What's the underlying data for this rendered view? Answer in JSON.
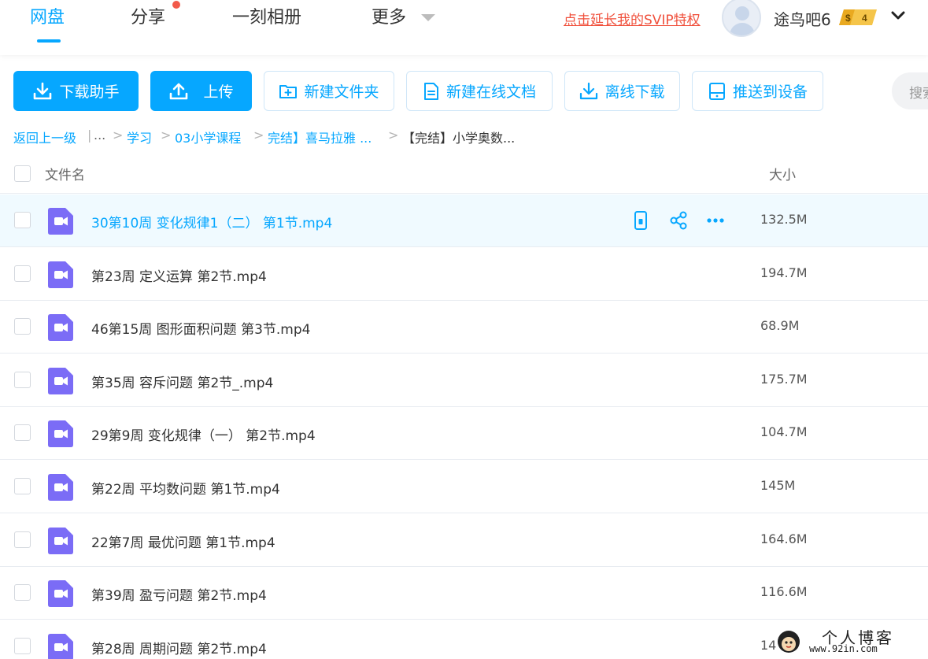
{
  "nav": {
    "tabs": [
      {
        "label": "网盘",
        "active": true
      },
      {
        "label": "分享",
        "has_dot": true
      },
      {
        "label": "一刻相册"
      },
      {
        "label": "更多"
      }
    ],
    "svip_link": "点击延长我的SVIP特权",
    "username": "途鸟吧6",
    "vip_level": "4",
    "vip_currency": "$"
  },
  "toolbar": {
    "download_helper": "下载助手",
    "upload": "上传",
    "new_folder": "新建文件夹",
    "new_online_doc": "新建在线文档",
    "offline_download": "离线下载",
    "push_to_device": "推送到设备",
    "search_placeholder": "搜索"
  },
  "breadcrumb": {
    "back": "返回上一级",
    "divider": "|",
    "ellipsis": "...",
    "items": [
      "学习",
      "03小学课程",
      "完结】喜马拉雅 ...",
      "【完结】小学奥数..."
    ]
  },
  "list": {
    "header_name": "文件名",
    "header_size": "大小",
    "files": [
      {
        "name": "30第10周 变化规律1（二） 第1节.mp4",
        "size": "132.5M",
        "hover": true
      },
      {
        "name": "第23周 定义运算 第2节.mp4",
        "size": "194.7M"
      },
      {
        "name": "46第15周 图形面积问题 第3节.mp4",
        "size": "68.9M"
      },
      {
        "name": "第35周 容斥问题 第2节_.mp4",
        "size": "175.7M"
      },
      {
        "name": "29第9周 变化规律（一） 第2节.mp4",
        "size": "104.7M"
      },
      {
        "name": "第22周 平均数问题 第1节.mp4",
        "size": "145M"
      },
      {
        "name": "22第7周 最优问题 第1节.mp4",
        "size": "164.6M"
      },
      {
        "name": "第39周 盈亏问题 第2节.mp4",
        "size": "116.6M"
      },
      {
        "name": "第28周 周期问题 第2节.mp4",
        "size": "14"
      }
    ]
  },
  "watermark": {
    "title": "个人博客",
    "url": "www.92in.com"
  },
  "colors": {
    "accent": "#06a7ff",
    "video_icon": "#7b6cf6",
    "svip_red": "#f0503c",
    "hover_row": "#f0faff"
  },
  "icons": {
    "download": "download-icon",
    "upload": "upload-icon",
    "folder_plus": "folder-plus-icon",
    "doc": "document-icon",
    "offline": "offline-download-icon",
    "device": "device-icon",
    "phone": "phone-icon",
    "share": "share-icon",
    "more": "more-icon",
    "video": "video-file-icon"
  }
}
